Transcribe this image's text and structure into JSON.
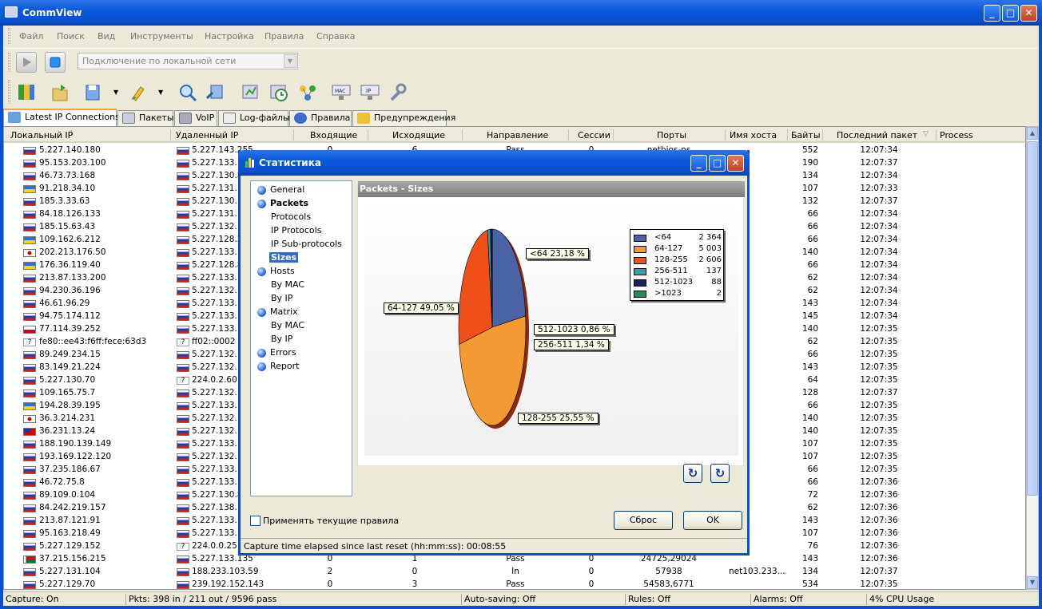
{
  "app": {
    "title": "CommView"
  },
  "menu": [
    "Файл",
    "Поиск",
    "Вид",
    "Инструменты",
    "Настройка",
    "Правила",
    "Справка"
  ],
  "toolbar": {
    "adapter": "Подключение по локальной сети"
  },
  "tabs": [
    "Latest IP Connections",
    "Пакеты",
    "VoIP",
    "Log-файлы",
    "Правила",
    "Предупреждения"
  ],
  "columns": [
    "Локальный IP",
    "Удаленный IP",
    "Входящие",
    "Исходящие",
    "Направление",
    "Сессии",
    "Порты",
    "Имя хоста",
    "Байты",
    "Последний пакет",
    "Process"
  ],
  "rows": [
    {
      "f": "ru",
      "l": "5.227.140.180",
      "rf": "ru",
      "r": "5.227.143.255",
      "in": "0",
      "out": "6",
      "dir": "Pass",
      "s": "0",
      "p": "netbios-ns",
      "h": "",
      "b": "552",
      "t": "12:07:34"
    },
    {
      "f": "ru",
      "l": "95.153.203.100",
      "rf": "ru",
      "r": "5.227.133.1",
      "in": "",
      "out": "",
      "dir": "",
      "s": "",
      "p": "",
      "h": "",
      "b": "190",
      "t": "12:07:37"
    },
    {
      "f": "ru",
      "l": "46.73.73.168",
      "rf": "ru",
      "r": "5.227.130.8",
      "in": "",
      "out": "",
      "dir": "",
      "s": "",
      "p": "",
      "h": "",
      "b": "134",
      "t": "12:07:34"
    },
    {
      "f": "ua",
      "l": "91.218.34.10",
      "rf": "ru",
      "r": "5.227.131.1",
      "in": "",
      "out": "",
      "dir": "",
      "s": "",
      "p": "",
      "h": "",
      "b": "107",
      "t": "12:07:33"
    },
    {
      "f": "ru",
      "l": "185.3.33.63",
      "rf": "ru",
      "r": "5.227.130.1",
      "in": "",
      "out": "",
      "dir": "",
      "s": "",
      "p": "",
      "h": "",
      "b": "132",
      "t": "12:07:37"
    },
    {
      "f": "ru",
      "l": "84.18.126.133",
      "rf": "ru",
      "r": "5.227.131.1",
      "in": "",
      "out": "",
      "dir": "",
      "s": "",
      "p": "",
      "h": "",
      "b": "66",
      "t": "12:07:34"
    },
    {
      "f": "ru",
      "l": "185.15.63.43",
      "rf": "ru",
      "r": "5.227.132.1",
      "in": "",
      "out": "",
      "dir": "",
      "s": "",
      "p": "",
      "h": "",
      "b": "66",
      "t": "12:07:34"
    },
    {
      "f": "ua",
      "l": "109.162.6.212",
      "rf": "ru",
      "r": "5.227.128.2",
      "in": "",
      "out": "",
      "dir": "",
      "s": "",
      "p": "",
      "h": "",
      "b": "66",
      "t": "12:07:34"
    },
    {
      "f": "jp",
      "l": "202.213.176.50",
      "rf": "ru",
      "r": "5.227.133.1",
      "in": "",
      "out": "",
      "dir": "",
      "s": "",
      "p": "",
      "h": "",
      "b": "140",
      "t": "12:07:34"
    },
    {
      "f": "ua",
      "l": "176.36.119.40",
      "rf": "ru",
      "r": "5.227.128.8",
      "in": "",
      "out": "",
      "dir": "",
      "s": "",
      "p": "",
      "h": "",
      "b": "66",
      "t": "12:07:34"
    },
    {
      "f": "ru",
      "l": "213.87.133.200",
      "rf": "ru",
      "r": "5.227.133.1",
      "in": "",
      "out": "",
      "dir": "",
      "s": "",
      "p": "",
      "h": "",
      "b": "62",
      "t": "12:07:34"
    },
    {
      "f": "ru",
      "l": "94.230.36.196",
      "rf": "ru",
      "r": "5.227.132.1",
      "in": "",
      "out": "",
      "dir": "",
      "s": "",
      "p": "",
      "h": "",
      "b": "62",
      "t": "12:07:34"
    },
    {
      "f": "ru",
      "l": "46.61.96.29",
      "rf": "ru",
      "r": "5.227.133.1",
      "in": "",
      "out": "",
      "dir": "",
      "s": "",
      "p": "",
      "h": "",
      "b": "143",
      "t": "12:07:34"
    },
    {
      "f": "ru",
      "l": "94.75.174.112",
      "rf": "ru",
      "r": "5.227.133.1",
      "in": "",
      "out": "",
      "dir": "",
      "s": "",
      "p": "",
      "h": "",
      "b": "145",
      "t": "12:07:34"
    },
    {
      "f": "pl",
      "l": "77.114.39.252",
      "rf": "ru",
      "r": "5.227.133.1",
      "in": "",
      "out": "",
      "dir": "",
      "s": "",
      "p": "",
      "h": "",
      "b": "140",
      "t": "12:07:35"
    },
    {
      "f": "q",
      "l": "fe80::ee43:f6ff:fece:63d3",
      "rf": "q",
      "r": "ff02::0002",
      "in": "",
      "out": "",
      "dir": "",
      "s": "",
      "p": "",
      "h": "",
      "b": "62",
      "t": "12:07:35"
    },
    {
      "f": "ru",
      "l": "89.249.234.15",
      "rf": "ru",
      "r": "5.227.132.1",
      "in": "",
      "out": "",
      "dir": "",
      "s": "",
      "p": "",
      "h": "",
      "b": "66",
      "t": "12:07:35"
    },
    {
      "f": "ru",
      "l": "83.149.21.224",
      "rf": "ru",
      "r": "5.227.132.1",
      "in": "",
      "out": "",
      "dir": "",
      "s": "",
      "p": "",
      "h": "",
      "b": "143",
      "t": "12:07:35"
    },
    {
      "f": "ru",
      "l": "5.227.130.70",
      "rf": "q",
      "r": "224.0.2.60",
      "in": "",
      "out": "",
      "dir": "",
      "s": "",
      "p": "",
      "h": "",
      "b": "64",
      "t": "12:07:35"
    },
    {
      "f": "ru",
      "l": "109.165.75.7",
      "rf": "ru",
      "r": "5.227.132.1",
      "in": "",
      "out": "",
      "dir": "",
      "s": "",
      "p": "",
      "h": "",
      "b": "128",
      "t": "12:07:37"
    },
    {
      "f": "ua",
      "l": "194.28.39.195",
      "rf": "ru",
      "r": "5.227.133.1",
      "in": "",
      "out": "",
      "dir": "",
      "s": "",
      "p": "",
      "h": "",
      "b": "66",
      "t": "12:07:35"
    },
    {
      "f": "jp",
      "l": "36.3.214.231",
      "rf": "ru",
      "r": "5.227.132.1",
      "in": "",
      "out": "",
      "dir": "",
      "s": "",
      "p": "",
      "h": "",
      "b": "140",
      "t": "12:07:35"
    },
    {
      "f": "tw",
      "l": "36.231.13.24",
      "rf": "ru",
      "r": "5.227.132.1",
      "in": "",
      "out": "",
      "dir": "",
      "s": "",
      "p": "",
      "h": "",
      "b": "140",
      "t": "12:07:35"
    },
    {
      "f": "ru",
      "l": "188.190.139.149",
      "rf": "ru",
      "r": "5.227.133.1",
      "in": "",
      "out": "",
      "dir": "",
      "s": "",
      "p": "",
      "h": "",
      "b": "107",
      "t": "12:07:35"
    },
    {
      "f": "ru",
      "l": "193.169.122.120",
      "rf": "ru",
      "r": "5.227.132.1",
      "in": "",
      "out": "",
      "dir": "",
      "s": "",
      "p": "",
      "h": "",
      "b": "107",
      "t": "12:07:35"
    },
    {
      "f": "ru",
      "l": "37.235.186.67",
      "rf": "ru",
      "r": "5.227.133.1",
      "in": "",
      "out": "",
      "dir": "",
      "s": "",
      "p": "",
      "h": "",
      "b": "66",
      "t": "12:07:35"
    },
    {
      "f": "ru",
      "l": "46.72.75.8",
      "rf": "ru",
      "r": "5.227.133.1",
      "in": "",
      "out": "",
      "dir": "",
      "s": "",
      "p": "",
      "h": "",
      "b": "66",
      "t": "12:07:36"
    },
    {
      "f": "ru",
      "l": "89.109.0.104",
      "rf": "ru",
      "r": "5.227.130.8",
      "in": "",
      "out": "",
      "dir": "",
      "s": "",
      "p": "",
      "h": "",
      "b": "72",
      "t": "12:07:36"
    },
    {
      "f": "ru",
      "l": "84.242.219.157",
      "rf": "ru",
      "r": "5.227.138.1",
      "in": "",
      "out": "",
      "dir": "",
      "s": "",
      "p": "",
      "h": "",
      "b": "62",
      "t": "12:07:36"
    },
    {
      "f": "ru",
      "l": "213.87.121.91",
      "rf": "ru",
      "r": "5.227.133.1",
      "in": "",
      "out": "",
      "dir": "",
      "s": "",
      "p": "",
      "h": "",
      "b": "143",
      "t": "12:07:36"
    },
    {
      "f": "ru",
      "l": "95.163.218.49",
      "rf": "ru",
      "r": "5.227.133.1",
      "in": "",
      "out": "",
      "dir": "",
      "s": "",
      "p": "",
      "h": "",
      "b": "107",
      "t": "12:07:36"
    },
    {
      "f": "ru",
      "l": "5.227.129.152",
      "rf": "q",
      "r": "224.0.0.25",
      "in": "",
      "out": "",
      "dir": "",
      "s": "",
      "p": "",
      "h": "",
      "b": "76",
      "t": "12:07:36"
    },
    {
      "f": "by",
      "l": "37.215.156.215",
      "rf": "ru",
      "r": "5.227.133.135",
      "in": "0",
      "out": "1",
      "dir": "Pass",
      "s": "0",
      "p": "24725,29024",
      "h": "",
      "b": "143",
      "t": "12:07:36"
    },
    {
      "f": "ru",
      "l": "5.227.131.104",
      "rf": "ru",
      "r": "188.233.103.59",
      "in": "2",
      "out": "0",
      "dir": "In",
      "s": "0",
      "p": "57938",
      "h": "net103.233....",
      "b": "134",
      "t": "12:07:37"
    },
    {
      "f": "ru",
      "l": "5.227.129.70",
      "rf": "ru",
      "r": "239.192.152.143",
      "in": "0",
      "out": "3",
      "dir": "Pass",
      "s": "0",
      "p": "54583,6771",
      "h": "",
      "b": "534",
      "t": "12:07:35"
    }
  ],
  "statusbar": [
    "Capture: On",
    "Pkts: 398 in / 211 out / 9596 pass",
    "Auto-saving: Off",
    "Rules: Off",
    "Alarms: Off",
    "4% CPU Usage"
  ],
  "dialog": {
    "title": "Статистика",
    "tree": [
      {
        "label": "General",
        "level": 0,
        "bold": false,
        "sel": false
      },
      {
        "label": "Packets",
        "level": 0,
        "bold": true,
        "sel": false
      },
      {
        "label": "Protocols",
        "level": 1,
        "bold": false,
        "sel": false
      },
      {
        "label": "IP Protocols",
        "level": 1,
        "bold": false,
        "sel": false
      },
      {
        "label": "IP Sub-protocols",
        "level": 1,
        "bold": false,
        "sel": false
      },
      {
        "label": "Sizes",
        "level": 1,
        "bold": true,
        "sel": true
      },
      {
        "label": "Hosts",
        "level": 0,
        "bold": false,
        "sel": false
      },
      {
        "label": "By MAC",
        "level": 1,
        "bold": false,
        "sel": false
      },
      {
        "label": "By IP",
        "level": 1,
        "bold": false,
        "sel": false
      },
      {
        "label": "Matrix",
        "level": 0,
        "bold": false,
        "sel": false
      },
      {
        "label": "By MAC",
        "level": 1,
        "bold": false,
        "sel": false
      },
      {
        "label": "By IP",
        "level": 1,
        "bold": false,
        "sel": false
      },
      {
        "label": "Errors",
        "level": 0,
        "bold": false,
        "sel": false
      },
      {
        "label": "Report",
        "level": 0,
        "bold": false,
        "sel": false
      }
    ],
    "panel_title": "Packets - Sizes",
    "apply_rules": "Применять текущие правила",
    "reset": "Сброс",
    "ok": "OK",
    "elapsed": "Capture time elapsed since last reset (hh:mm:ss): 00:08:55"
  },
  "chart_data": {
    "type": "pie",
    "categories": [
      "<64",
      "64-127",
      "128-255",
      "256-511",
      "512-1023",
      ">1023"
    ],
    "values": [
      2364,
      5003,
      2606,
      137,
      88,
      2
    ],
    "value_labels": [
      "2 364",
      "5 003",
      "2 606",
      "137",
      "88",
      "2"
    ],
    "slice_labels": [
      "<64  23,18 %",
      "64-127  49,05 %",
      "128-255  25,55 %",
      "256-511  1,34 %",
      "512-1023  0,86 %",
      ""
    ],
    "colors": [
      "#4a63a4",
      "#f39a32",
      "#f05018",
      "#3aa0a8",
      "#1a2060",
      "#2a8a5a"
    ]
  }
}
